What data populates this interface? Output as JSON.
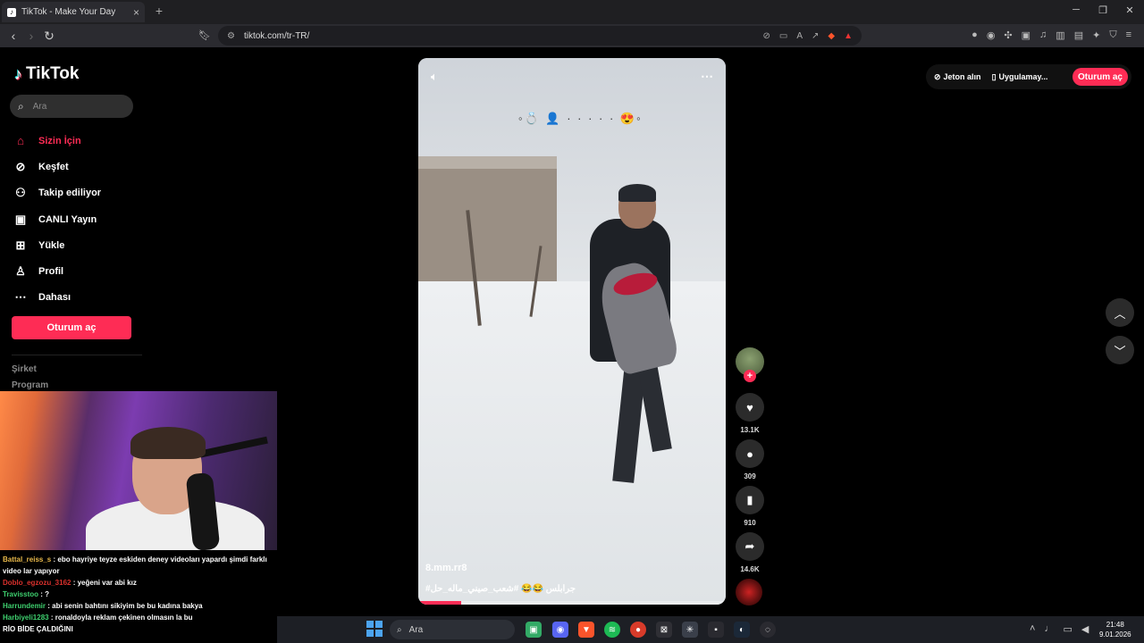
{
  "browser": {
    "tab_title": "TikTok - Make Your Day",
    "url": "tiktok.com/tr-TR/"
  },
  "sidebar": {
    "logo": "TikTok",
    "search_placeholder": "Ara",
    "items": [
      {
        "label": "Sizin İçin",
        "icon": "home-icon",
        "active": true
      },
      {
        "label": "Keşfet",
        "icon": "compass-icon",
        "active": false
      },
      {
        "label": "Takip ediliyor",
        "icon": "following-icon",
        "active": false
      },
      {
        "label": "CANLI Yayın",
        "icon": "live-icon",
        "active": false
      },
      {
        "label": "Yükle",
        "icon": "upload-icon",
        "active": false
      },
      {
        "label": "Profil",
        "icon": "profile-icon",
        "active": false
      },
      {
        "label": "Dahası",
        "icon": "more-icon",
        "active": false
      }
    ],
    "login_label": "Oturum aç",
    "footer_links": [
      "Şirket",
      "Program"
    ]
  },
  "topbar": {
    "coins_label": "Jeton alın",
    "app_label": "Uygulamay...",
    "login_label": "Oturum aç"
  },
  "video": {
    "username": "8.mm.rr8",
    "caption": "#جرابلس 😂😂 #شعب_صيني_ماله_حل",
    "progress_fraction": 0.14
  },
  "actions": {
    "likes": "13.1K",
    "comments": "309",
    "saves": "910",
    "shares": "14.6K"
  },
  "chat": [
    {
      "user": "Battal_reiss_s",
      "color": "#e8b84a",
      "text": ": ebo hayriye teyze eskiden deney videoları yapardı şimdi farklı video lar yapıyor"
    },
    {
      "user": "Doblo_egzozu_3162",
      "color": "#d9302c",
      "text": ": yeğeni var abi kız"
    },
    {
      "user": "Travisstoo",
      "color": "#3ecf6e",
      "text": ": ?"
    },
    {
      "user": "Harrundemir",
      "color": "#3ecf6e",
      "text": ": abi senin bahtını sikiyim be bu kadına bakya"
    },
    {
      "user": "Harbiyeli1283",
      "color": "#3ecf6e",
      "text": ": ronaldoyla reklam çekinen olmasın la bu"
    },
    {
      "user": "",
      "color": "#fff",
      "text": "RİO BİDE ÇALDIĞINI"
    }
  ],
  "taskbar": {
    "search_placeholder": "Ara",
    "time": "21:48",
    "date": "9.01.2026"
  },
  "colors": {
    "accent": "#fe2c55",
    "background": "#000000"
  }
}
